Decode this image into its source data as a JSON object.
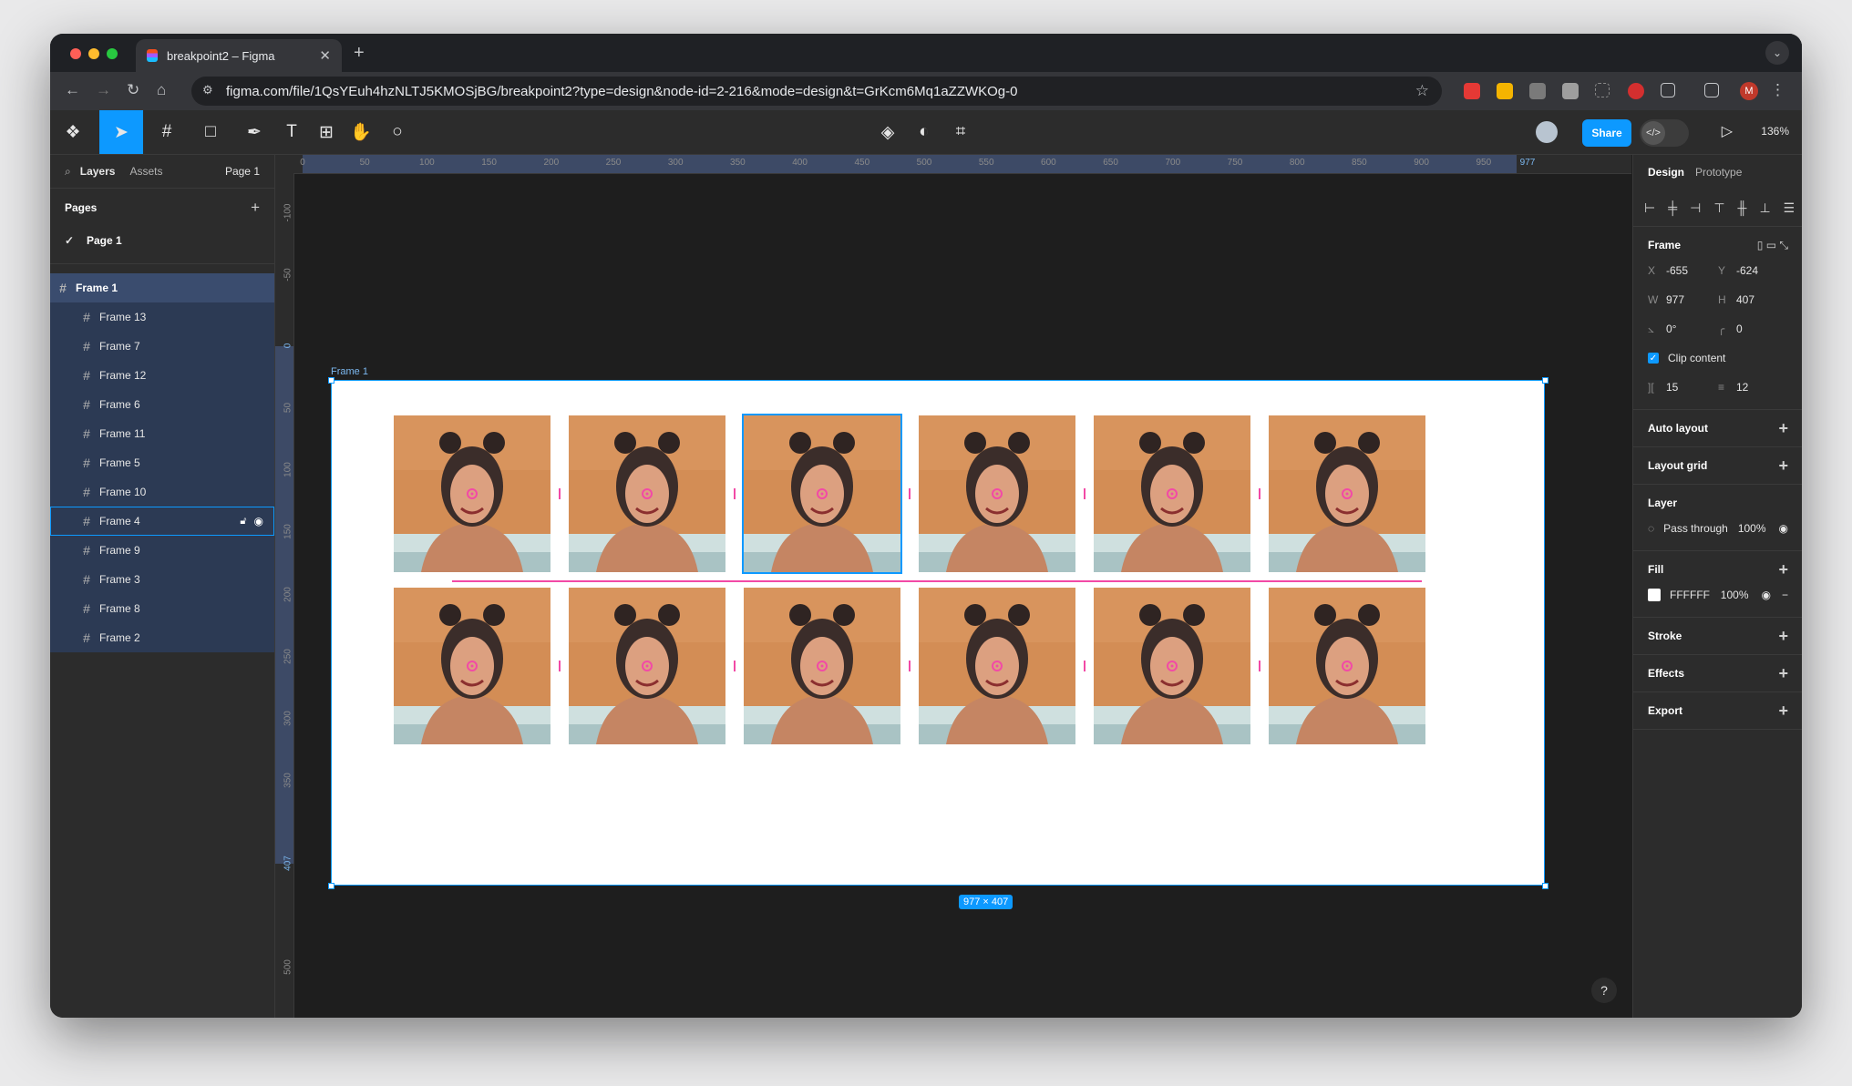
{
  "browser": {
    "tab_title": "breakpoint2 – Figma",
    "url": "figma.com/file/1QsYEuh4hzNLTJ5KMOSjBG/breakpoint2?type=design&node-id=2-216&mode=design&t=GrKcm6Mq1aZZWKOg-0",
    "profile_initial": "M"
  },
  "toolbar": {
    "share_label": "Share",
    "zoom": "136%"
  },
  "left_panel": {
    "tabs": [
      "Layers",
      "Assets"
    ],
    "page_selector": "Page 1",
    "pages_heading": "Pages",
    "pages": [
      "Page 1"
    ],
    "root_layer": "Frame 1",
    "layers": [
      "Frame 13",
      "Frame 7",
      "Frame 12",
      "Frame 6",
      "Frame 11",
      "Frame 5",
      "Frame 10",
      "Frame 4",
      "Frame 9",
      "Frame 3",
      "Frame 8",
      "Frame 2"
    ]
  },
  "rulers": {
    "top": [
      "0",
      "50",
      "100",
      "150",
      "200",
      "250",
      "300",
      "350",
      "400",
      "450",
      "500",
      "550",
      "600",
      "650",
      "700",
      "750",
      "800",
      "850",
      "900",
      "950",
      "977"
    ],
    "left": [
      "-100",
      "-50",
      "0",
      "50",
      "100",
      "150",
      "200",
      "250",
      "300",
      "350",
      "407",
      "500"
    ]
  },
  "canvas": {
    "frame_label": "Frame 1",
    "size_badge": "977 × 407"
  },
  "right_panel": {
    "tabs": [
      "Design",
      "Prototype"
    ],
    "frame_heading": "Frame",
    "x_label": "X",
    "x": "-655",
    "y_label": "Y",
    "y": "-624",
    "w_label": "W",
    "w": "977",
    "h_label": "H",
    "h": "407",
    "rotation": "0°",
    "radius": "0",
    "clip_content": "Clip content",
    "padding_h": "15",
    "padding_v": "12",
    "auto_layout": "Auto layout",
    "layout_grid": "Layout grid",
    "layer_heading": "Layer",
    "blend_mode": "Pass through",
    "layer_opacity": "100%",
    "fill_heading": "Fill",
    "fill_hex": "FFFFFF",
    "fill_opacity": "100%",
    "stroke": "Stroke",
    "effects": "Effects",
    "export": "Export"
  }
}
